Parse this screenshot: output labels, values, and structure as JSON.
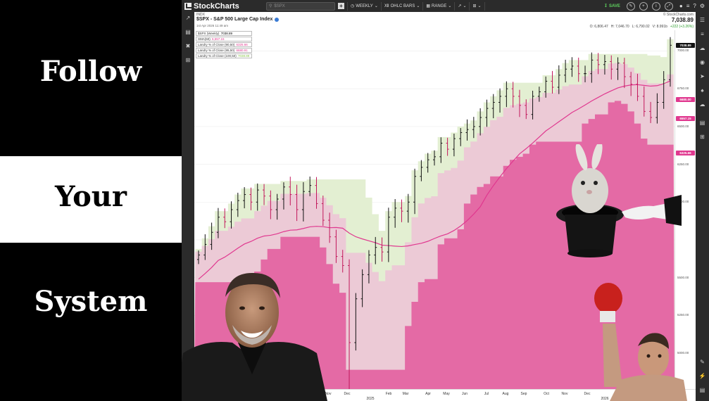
{
  "left_panel": {
    "word_1": "Follow",
    "word_2": "Your",
    "word_3": "System"
  },
  "toolbar": {
    "brand": "StockCharts",
    "search_value": "$SPX",
    "period_label": "WEEKLY",
    "chart_type_label": "OHLC BARS",
    "range_label": "RANGE",
    "save_label": "SAVE"
  },
  "chart_header": {
    "exchange": "INDX",
    "title": "$SPX - S&P 500 Large Cap Index",
    "date": "1st Apr 2026 11:49 am",
    "brand": "© StockCharts.com",
    "last_price": "7,038.89",
    "open": "O: 6,806.47",
    "high": "H: 7,046.70",
    "low": "L: 6,790.02",
    "volume": "V: 8.991b",
    "change": "+222 (+3.26%)"
  },
  "legend": [
    {
      "label": "$SPX (Weekly)",
      "value": "7038.89",
      "color": "#000000"
    },
    {
      "label": "SMA(50)",
      "value": "6,557.15",
      "color": "#e0388f"
    },
    {
      "label": "Landry % of Close (90,50)",
      "value": "6325.66",
      "color": "#e0388f"
    },
    {
      "label": "Landry % of Close (95,50)",
      "value": "6680.91",
      "color": "#e0388f"
    },
    {
      "label": "Landry % of Close (100,50)",
      "value": "7038.89",
      "color": "#8bc34a"
    }
  ],
  "price_axis": {
    "labels": [
      "7000.00",
      "6750.00",
      "6500.00",
      "6250.00",
      "6000.00",
      "5500.00",
      "5250.00",
      "5000.00"
    ],
    "tags": [
      {
        "text": "7038.89",
        "color": "#111111"
      },
      {
        "text": "6680.00",
        "color": "#e0388f"
      },
      {
        "text": "6557.15",
        "color": "#e0388f"
      },
      {
        "text": "6325.66",
        "color": "#e0388f"
      }
    ]
  },
  "date_axis": {
    "months": [
      "Nov",
      "Dec",
      "Feb",
      "Mar",
      "Apr",
      "May",
      "Jun",
      "Jul",
      "Aug",
      "Sep",
      "Oct",
      "Nov",
      "Dec",
      "Feb"
    ],
    "years": [
      "2025",
      "2026"
    ]
  },
  "chart_data": {
    "type": "ohlc",
    "title": "$SPX - S&P 500 Large Cap Index",
    "period": "weekly",
    "ylim": [
      4800,
      7100
    ],
    "closes": [
      5650,
      5720,
      5800,
      5900,
      5870,
      5950,
      6010,
      6050,
      6000,
      6080,
      6040,
      5950,
      6020,
      6100,
      6050,
      5950,
      6070,
      6110,
      5990,
      5880,
      5770,
      5640,
      5580,
      5070,
      5360,
      5520,
      5650,
      5700,
      5670,
      5900,
      5960,
      5940,
      6000,
      6170,
      6230,
      6280,
      6300,
      6390,
      6350,
      6420,
      6460,
      6480,
      6500,
      6560,
      6620,
      6660,
      6700,
      6750,
      6700,
      6640,
      6580,
      6700,
      6730,
      6800,
      6760,
      6840,
      6880,
      6900,
      6850,
      6850,
      6940,
      6910,
      6930,
      6880,
      6920,
      6830,
      6780,
      6700,
      6600,
      6560,
      6660,
      6810,
      7038
    ],
    "sma_50": "6557.15",
    "landry_90": "6325.66",
    "landry_95": "6680.91",
    "landry_100": "7038.89",
    "colors": {
      "up": "#111111",
      "down": "#c2185b",
      "sma": "#e0388f",
      "band_fill": "#e46aa5",
      "band_mid": "#eccad6",
      "band_top": "#e3efd2"
    }
  }
}
